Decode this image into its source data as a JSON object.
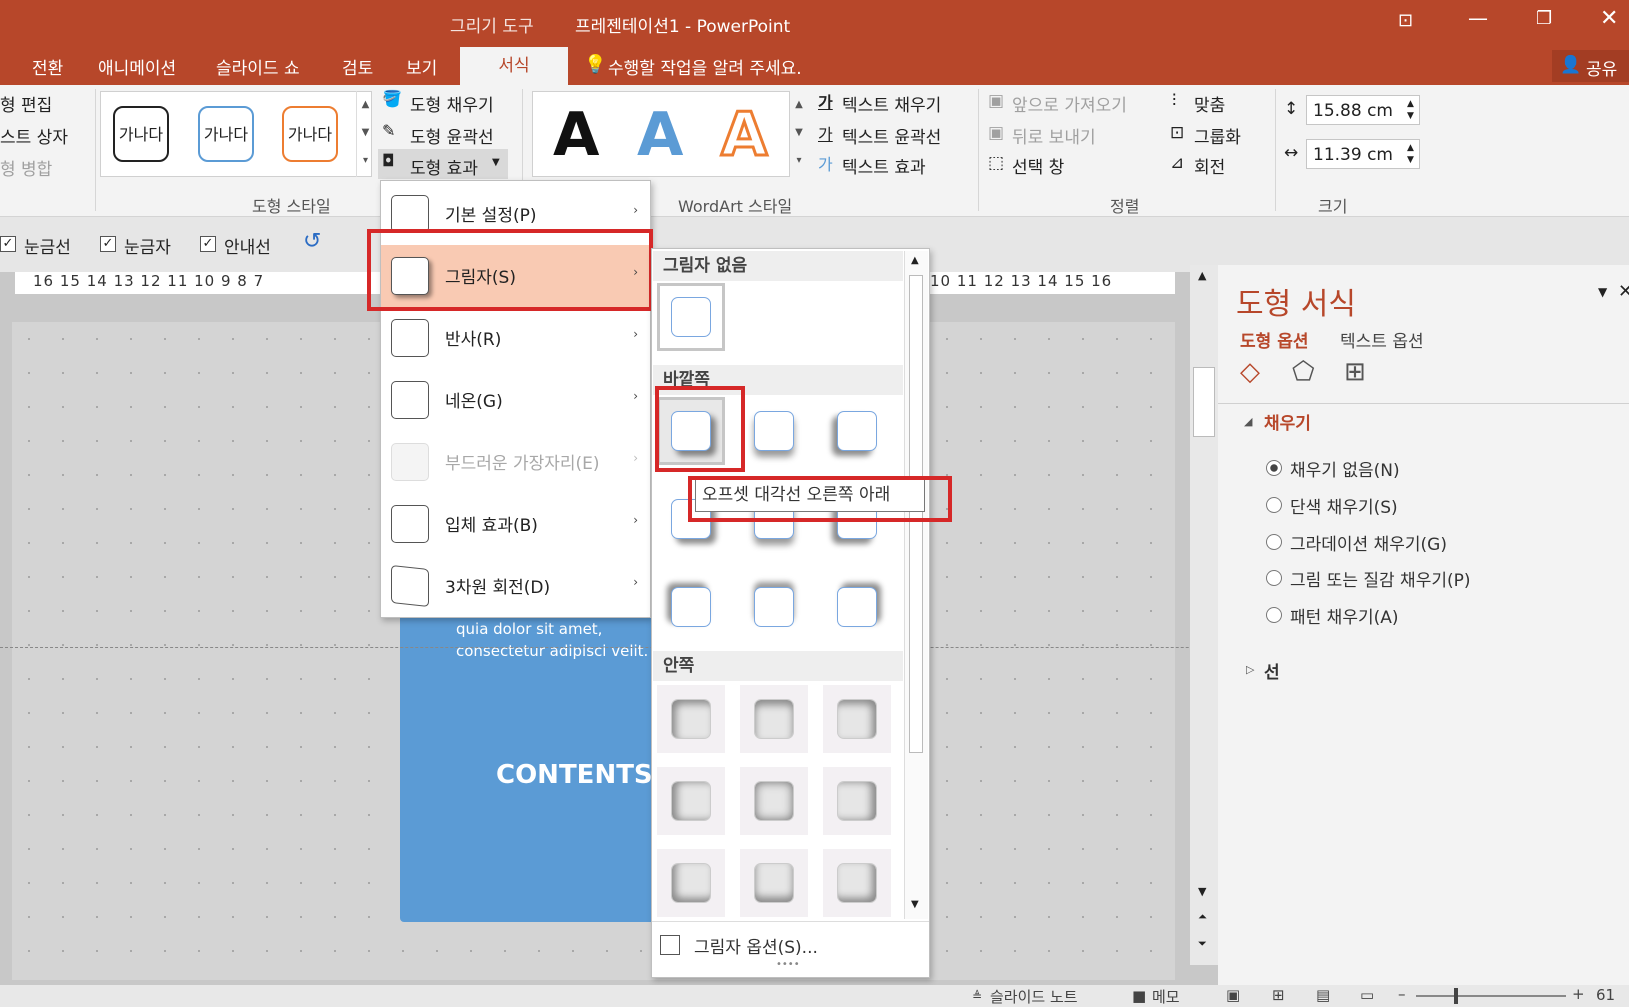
{
  "title": {
    "app_title": "프레젠테이션1 - PowerPoint",
    "context_tab": "그리기 도구"
  },
  "tabs": [
    "전환",
    "애니메이션",
    "슬라이드 쇼",
    "검토",
    "보기"
  ],
  "active_tab": "서식",
  "tell_me": "수행할 작업을 알려 주세요.",
  "share": "공유",
  "ribbon": {
    "left_items": [
      "형 편집",
      "스트 상자",
      "형 병합"
    ],
    "style_swatch": "가나다",
    "shape_fill": "도형 채우기",
    "shape_outline": "도형 윤곽선",
    "shape_effects": "도형 효과",
    "group_shape_styles": "도형 스타일",
    "wordart_letter": "A",
    "group_wordart": "WordArt 스타일",
    "text_fill": "텍스트 채우기",
    "text_outline": "텍스트 윤곽선",
    "text_effects": "텍스트 효과",
    "bring_forward": "앞으로 가져오기",
    "send_backward": "뒤로 보내기",
    "selection_pane": "선택 창",
    "align": "맞춤",
    "group": "그룹화",
    "rotate": "회전",
    "group_arrange": "정렬",
    "height": "15.88 cm",
    "width": "11.39 cm",
    "group_size": "크기"
  },
  "show": {
    "gridlines": "눈금선",
    "ruler": "눈금자",
    "guides": "안내선"
  },
  "ruler_left": "16 15 14 13 12 11 10  9  8  7",
  "ruler_right": "10 11 12 13 14 15 16",
  "menu": {
    "items": [
      {
        "label": "기본 설정(P)"
      },
      {
        "label": "그림자(S)"
      },
      {
        "label": "반사(R)"
      },
      {
        "label": "네온(G)"
      },
      {
        "label": "부드러운 가장자리(E)"
      },
      {
        "label": "입체 효과(B)"
      },
      {
        "label": "3차원 회전(D)"
      }
    ]
  },
  "shadow": {
    "no_shadow": "그림자 없음",
    "outer": "바깥쪽",
    "inner": "안쪽",
    "options": "그림자 옵션(S)...",
    "tooltip": "오프셋 대각선 오른쪽 아래"
  },
  "slide": {
    "body_text_1": "quia dolor sit amet,",
    "body_text_2": "consectetur adipisci velit.",
    "contents": "CONTENTS"
  },
  "panel": {
    "title": "도형 서식",
    "tab_shape": "도형 옵션",
    "tab_text": "텍스트 옵션",
    "fill_header": "채우기",
    "fill_options": [
      "채우기 없음(N)",
      "단색 채우기(S)",
      "그라데이션 채우기(G)",
      "그림 또는 질감 채우기(P)",
      "패턴 채우기(A)"
    ],
    "line_header": "선"
  },
  "status": {
    "notes": "슬라이드 노트",
    "comments": "메모",
    "zoom": "61"
  },
  "colors": {
    "accent": "#b7472a",
    "highlight": "#f9cab3",
    "redbox": "#d62828",
    "slide": "#5b9bd5"
  }
}
